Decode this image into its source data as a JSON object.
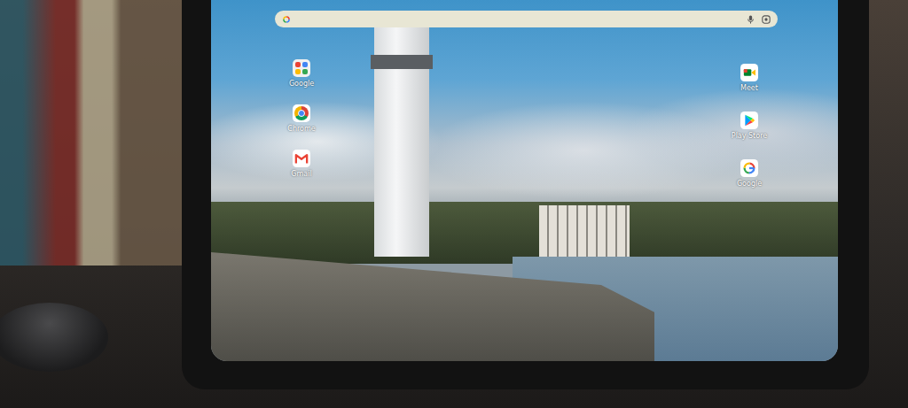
{
  "apps_left": [
    {
      "label": "Google",
      "kind": "folder"
    },
    {
      "label": "Chrome",
      "kind": "chrome"
    },
    {
      "label": "Gmail",
      "kind": "gmail"
    }
  ],
  "apps_right": [
    {
      "label": "Meet",
      "kind": "meet"
    },
    {
      "label": "Play Store",
      "kind": "play"
    },
    {
      "label": "Google",
      "kind": "google"
    }
  ]
}
